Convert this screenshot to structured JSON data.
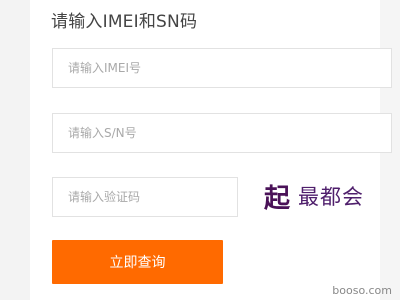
{
  "form": {
    "heading": "请输入IMEI和SN码",
    "imei_placeholder": "请输入IMEI号",
    "sn_placeholder": "请输入S/N号",
    "captcha_placeholder": "请输入验证码",
    "captcha_text_part1": "起",
    "captcha_text_part2": "最都会",
    "submit_label": "立即查询"
  },
  "watermark": "booso.com",
  "colors": {
    "accent": "#ff6a00",
    "captcha_text": "#4a1258",
    "page_background": "#f3f3f3"
  }
}
